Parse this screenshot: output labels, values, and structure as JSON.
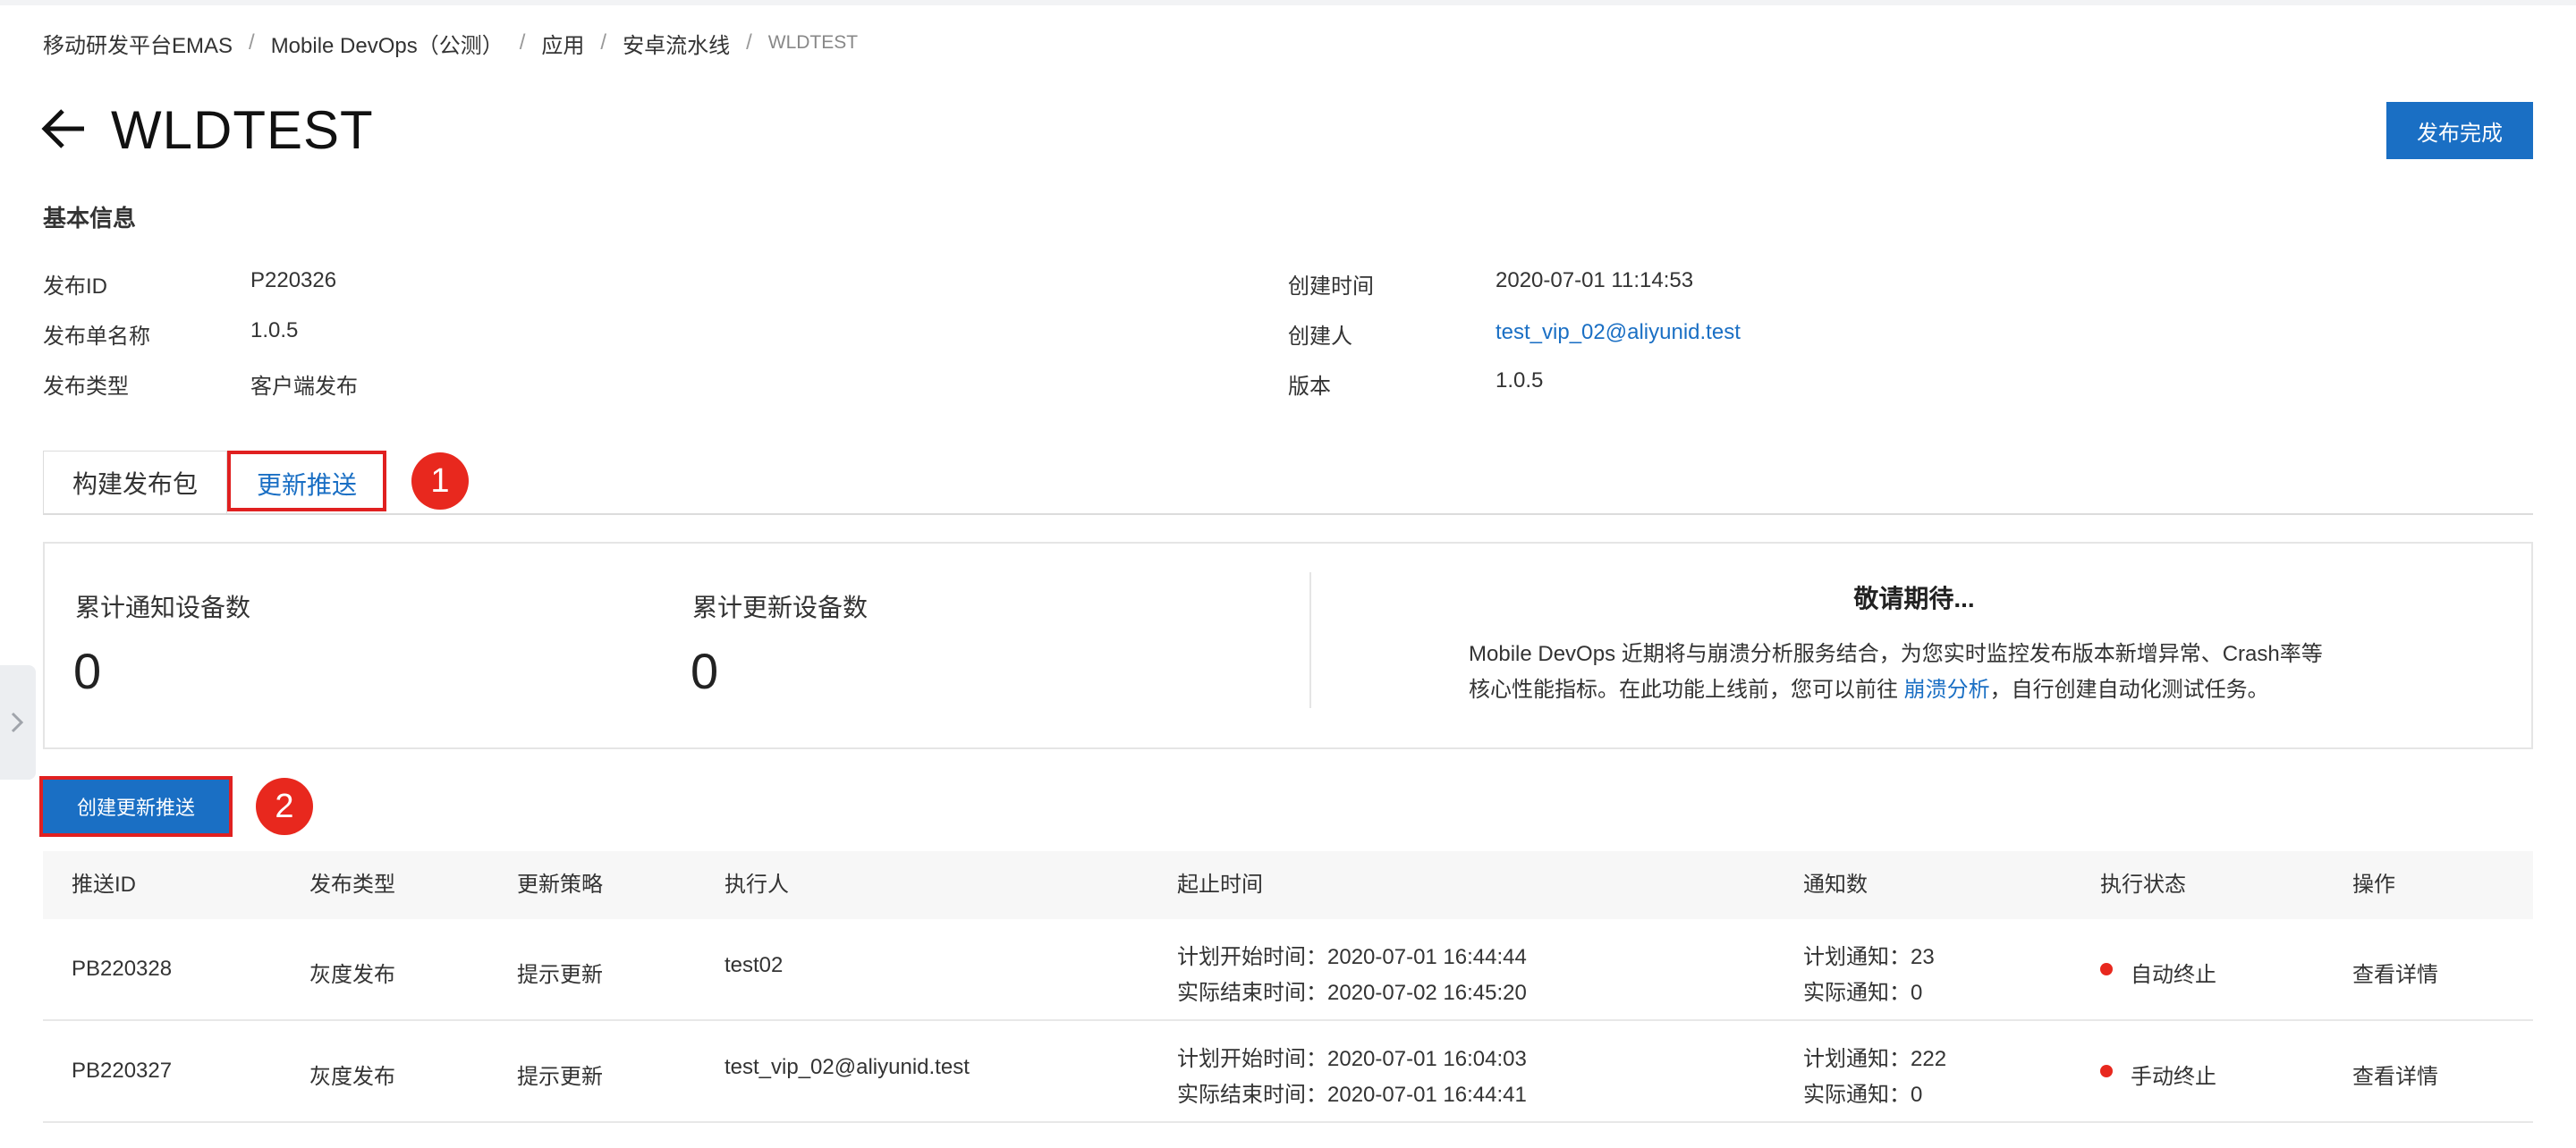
{
  "breadcrumb": {
    "items": [
      "移动研发平台EMAS",
      "Mobile DevOps（公测）",
      "应用",
      "安卓流水线"
    ],
    "current": "WLDTEST",
    "separator": "/"
  },
  "page": {
    "title": "WLDTEST",
    "publish_done_label": "发布完成"
  },
  "basic_info": {
    "title": "基本信息",
    "release_id_label": "发布ID",
    "release_id": "P220326",
    "release_name_label": "发布单名称",
    "release_name": "1.0.5",
    "release_type_label": "发布类型",
    "release_type": "客户端发布",
    "created_time_label": "创建时间",
    "created_time": "2020-07-01 11:14:53",
    "creator_label": "创建人",
    "creator": "test_vip_02@aliyunid.test",
    "version_label": "版本",
    "version": "1.0.5"
  },
  "tabs": {
    "build_label": "构建发布包",
    "push_label": "更新推送",
    "active": "更新推送"
  },
  "annotations": {
    "marker1": "1",
    "marker2": "2"
  },
  "stats": {
    "notified_label": "累计通知设备数",
    "notified_value": "0",
    "updated_label": "累计更新设备数",
    "updated_value": "0"
  },
  "coming_soon": {
    "title": "敬请期待...",
    "line1": "Mobile DevOps 近期将与崩溃分析服务结合，为您实时监控发布版本新增异常、Crash率等",
    "line2_prefix": "核心性能指标。在此功能上线前，您可以前往 ",
    "link": "崩溃分析",
    "line2_suffix": "，自行创建自动化测试任务。"
  },
  "create_push_label": "创建更新推送",
  "table": {
    "headers": {
      "push_id": "推送ID",
      "release_type": "发布类型",
      "strategy": "更新策略",
      "executor": "执行人",
      "time": "起止时间",
      "notify": "通知数",
      "status": "执行状态",
      "action": "操作"
    },
    "rows": [
      {
        "push_id": "PB220328",
        "release_type": "灰度发布",
        "strategy": "提示更新",
        "executor": "test02",
        "plan_start": "计划开始时间：2020-07-01 16:44:44",
        "actual_end": "实际结束时间：2020-07-02 16:45:20",
        "plan_notify": "计划通知：23",
        "actual_notify": "实际通知：0",
        "status": "自动终止",
        "action": "查看详情"
      },
      {
        "push_id": "PB220327",
        "release_type": "灰度发布",
        "strategy": "提示更新",
        "executor": "test_vip_02@aliyunid.test",
        "plan_start": "计划开始时间：2020-07-01 16:04:03",
        "actual_end": "实际结束时间：2020-07-01 16:44:41",
        "plan_notify": "计划通知：222",
        "actual_notify": "实际通知：0",
        "status": "手动终止",
        "action": "查看详情"
      }
    ]
  },
  "colors": {
    "accent": "#1a6fc4",
    "alert": "#e8281e",
    "status_dot": "#e8281e"
  },
  "icons": {
    "back": "arrow-left-icon",
    "side_toggle": "chevron-right-icon",
    "status": "dot-icon"
  }
}
